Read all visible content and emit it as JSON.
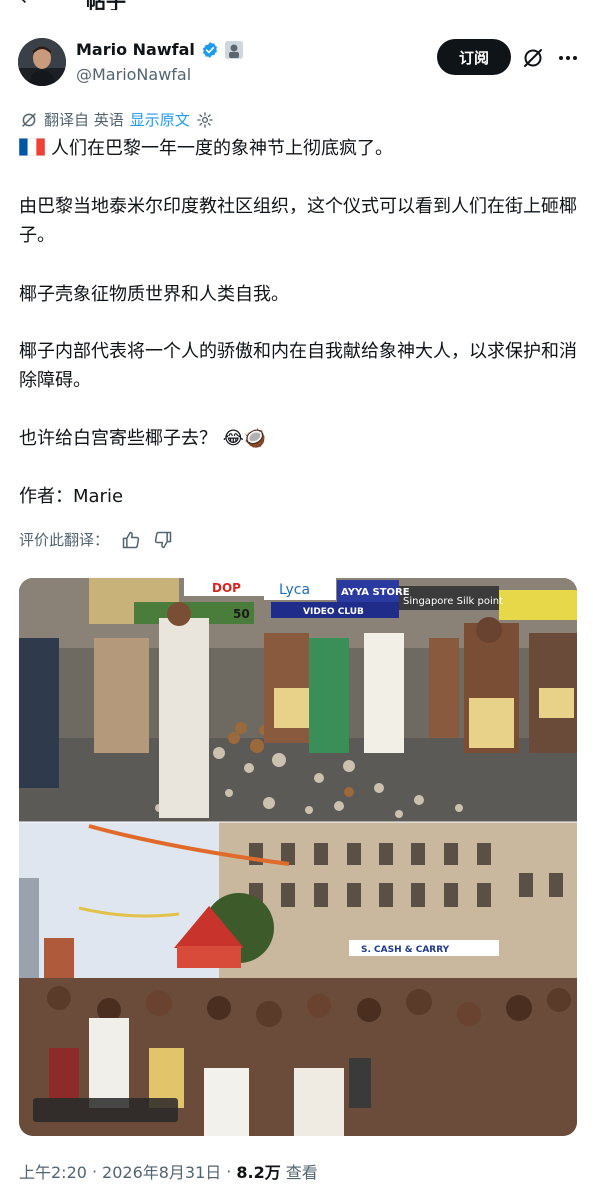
{
  "header": {
    "back_glyph": "←",
    "title": "帖子"
  },
  "author": {
    "name": "Mario Nawfal",
    "handle": "@MarioNawfal",
    "verified_icon": "verified-badge-icon",
    "affiliate_icon": "affiliate-badge-icon"
  },
  "actions": {
    "subscribe_label": "订阅",
    "grok_icon": "grok-icon",
    "more_icon": "more-icon"
  },
  "translation": {
    "prefix": "翻译自 英语",
    "show_original": "显示原文",
    "rate_label": "评价此翻译：",
    "thumbs_up_icon": "thumbs-up-icon",
    "thumbs_down_icon": "thumbs-down-icon"
  },
  "post": {
    "line1": "人们在巴黎一年一度的象神节上彻底疯了。",
    "para2": "由巴黎当地泰米尔印度教社区组织，这个仪式可以看到人们在街上砸椰子。",
    "para3": "椰子壳象征物质世界和人类自我。",
    "para4": "椰子内部代表将一个人的骄傲和内在自我献给象神大人，以求保护和消除障碍。",
    "para5": "也许给白宫寄些椰子去？",
    "para5_emoji": "😂🥥",
    "author_credit": "作者：Marie"
  },
  "media": {
    "signs": [
      "DOP",
      "Lyca",
      "AYYA STORE",
      "VIDEO CLUB",
      "Singapore Silk point",
      "S. CASH & CARRY",
      "50"
    ]
  },
  "meta": {
    "time": "上午2:20",
    "separator": "·",
    "date": "2026年8月31日",
    "views": "8.2万",
    "views_label": "查看"
  },
  "colors": {
    "accent": "#1d9bf0",
    "text": "#0f1419",
    "secondary": "#536471",
    "button_bg": "#0f1419"
  }
}
